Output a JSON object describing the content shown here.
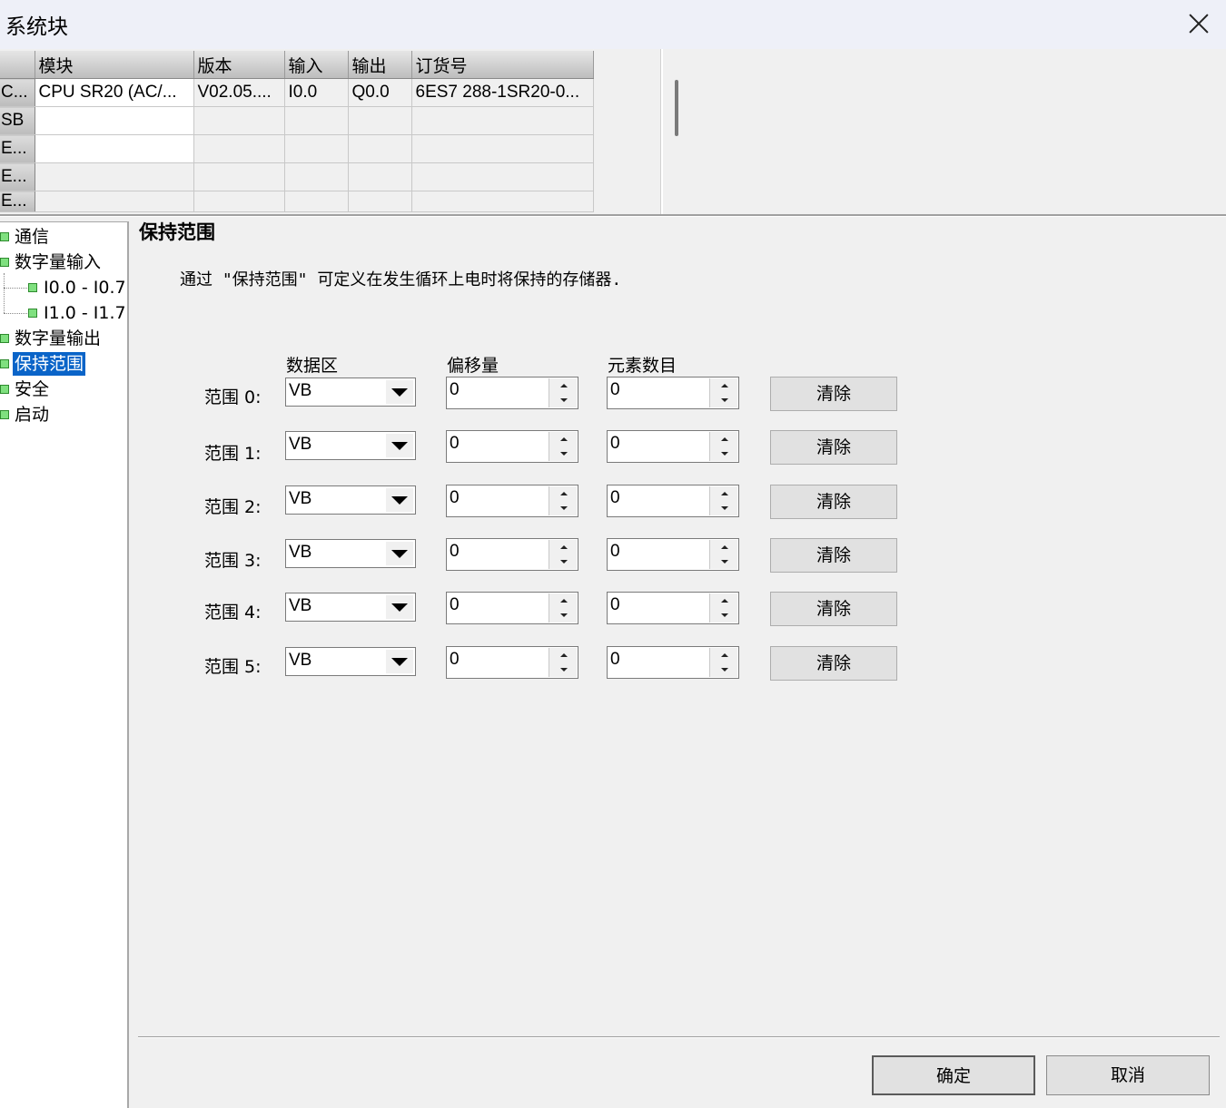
{
  "window": {
    "title": "系统块"
  },
  "module_table": {
    "headers": [
      "",
      "模块",
      "版本",
      "输入",
      "输出",
      "订货号"
    ],
    "rows": [
      [
        "C...",
        "CPU SR20 (AC/...",
        "V02.05....",
        "I0.0",
        "Q0.0",
        "6ES7 288-1SR20-0..."
      ],
      [
        "SB",
        "",
        "",
        "",
        "",
        ""
      ],
      [
        "E...",
        "",
        "",
        "",
        "",
        ""
      ],
      [
        "E...",
        "",
        "",
        "",
        "",
        ""
      ],
      [
        "E...",
        "",
        "",
        "",
        "",
        ""
      ]
    ]
  },
  "tree": {
    "items": [
      {
        "label": "通信"
      },
      {
        "label": "数字量输入"
      },
      {
        "label": "I0.0 - I0.7"
      },
      {
        "label": "I1.0 - I1.7"
      },
      {
        "label": "数字量输出"
      },
      {
        "label": "保持范围",
        "selected": true
      },
      {
        "label": "安全"
      },
      {
        "label": "启动"
      }
    ]
  },
  "panel": {
    "heading": "保持范围",
    "description": "通过 \"保持范围\" 可定义在发生循环上电时将保持的存储器.",
    "col_data_area": "数据区",
    "col_offset": "偏移量",
    "col_count": "元素数目",
    "ranges": [
      {
        "label": "范围 0:",
        "area": "VB",
        "offset": "0",
        "count": "0",
        "clear": "清除"
      },
      {
        "label": "范围 1:",
        "area": "VB",
        "offset": "0",
        "count": "0",
        "clear": "清除"
      },
      {
        "label": "范围 2:",
        "area": "VB",
        "offset": "0",
        "count": "0",
        "clear": "清除"
      },
      {
        "label": "范围 3:",
        "area": "VB",
        "offset": "0",
        "count": "0",
        "clear": "清除"
      },
      {
        "label": "范围 4:",
        "area": "VB",
        "offset": "0",
        "count": "0",
        "clear": "清除"
      },
      {
        "label": "范围 5:",
        "area": "VB",
        "offset": "0",
        "count": "0",
        "clear": "清除"
      }
    ]
  },
  "footer": {
    "ok": "确定",
    "cancel": "取消"
  }
}
